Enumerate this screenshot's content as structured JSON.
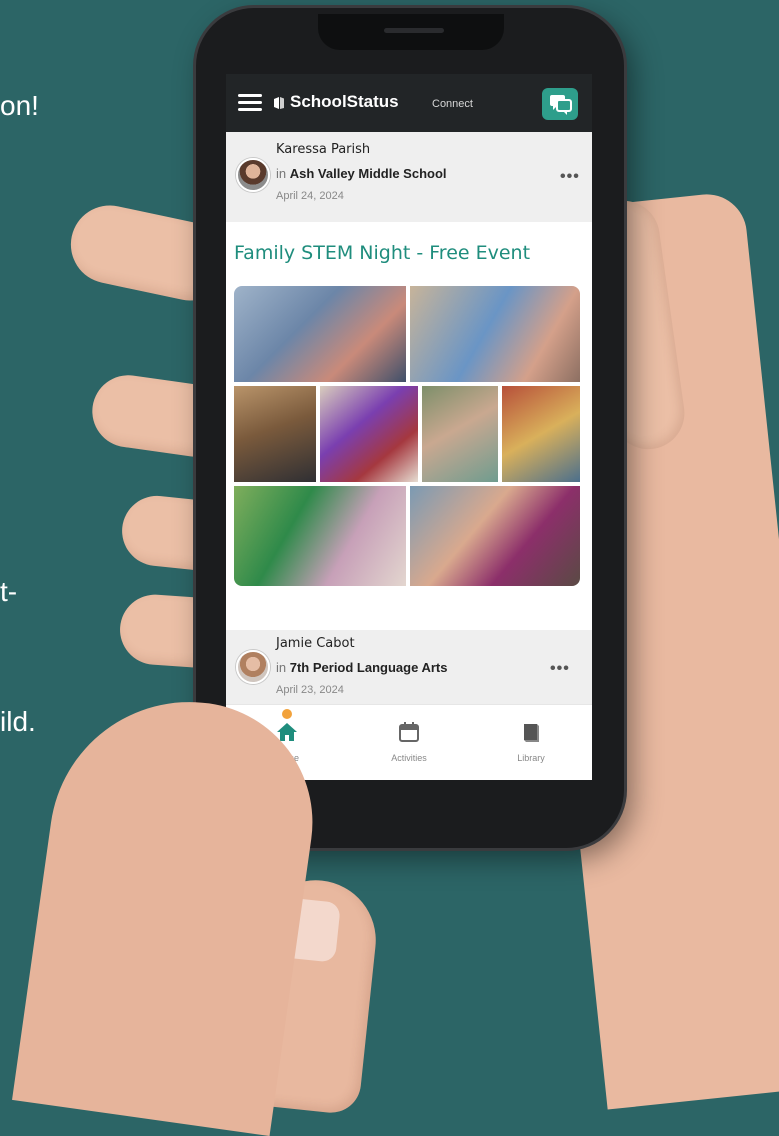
{
  "background_text": {
    "line1": "on!",
    "line2": "t-",
    "line3": "ild."
  },
  "app": {
    "brand": "SchoolStatus",
    "brand_sub": "Connect"
  },
  "post1": {
    "author": "Karessa Parish",
    "in_prefix": "in",
    "group": "Ash Valley Middle School",
    "date": "April 24, 2024",
    "more": "•••",
    "title": "Family STEM Night - Free Event"
  },
  "post2": {
    "author": "Jamie Cabot",
    "in_prefix": "in",
    "group": "7th Period Language Arts",
    "date": "April 23, 2024",
    "more": "•••"
  },
  "tabs": [
    {
      "label": "Home",
      "icon": "home-icon",
      "active": true
    },
    {
      "label": "Activities",
      "icon": "calendar-icon",
      "active": false
    },
    {
      "label": "Library",
      "icon": "book-icon",
      "active": false
    }
  ],
  "colors": {
    "background": "#2c6566",
    "accent": "#1f8d7d",
    "chat_button": "#2e9e8b",
    "badge": "#f2a23b",
    "header": "#222527"
  }
}
